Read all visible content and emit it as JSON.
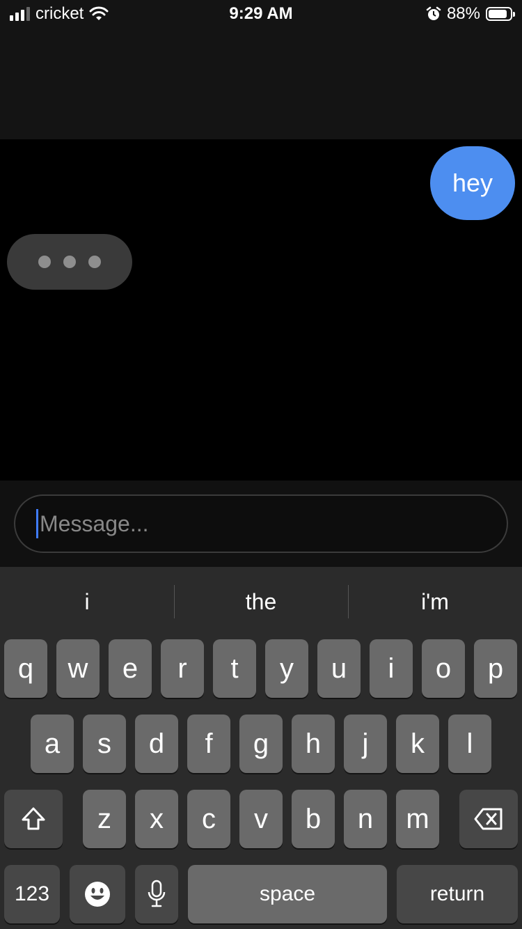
{
  "status_bar": {
    "carrier": "cricket",
    "time": "9:29 AM",
    "battery": "88%",
    "battery_level": 0.88
  },
  "chat": {
    "outgoing_message": "hey",
    "typing_indicator": "typing"
  },
  "composer": {
    "placeholder": "Message..."
  },
  "keyboard": {
    "suggestions": [
      "i",
      "the",
      "i'm"
    ],
    "row1": [
      "q",
      "w",
      "e",
      "r",
      "t",
      "y",
      "u",
      "i",
      "o",
      "p"
    ],
    "row2": [
      "a",
      "s",
      "d",
      "f",
      "g",
      "h",
      "j",
      "k",
      "l"
    ],
    "row3": [
      "z",
      "x",
      "c",
      "v",
      "b",
      "n",
      "m"
    ],
    "numbers_label": "123",
    "space_label": "space",
    "return_label": "return"
  },
  "colors": {
    "outgoing_bubble": "#4d8ef0",
    "caret": "#3f7cff"
  }
}
